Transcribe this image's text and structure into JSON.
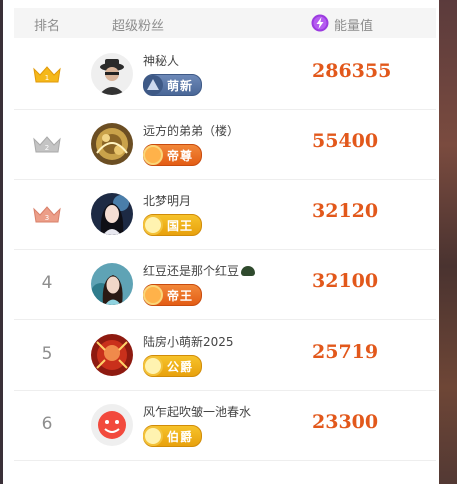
{
  "header": {
    "rank_label": "排名",
    "fan_label": "超级粉丝",
    "energy_label": "能量值"
  },
  "colors": {
    "energy": "#e2581b",
    "gold_crown": "#f5b81a",
    "silver_crown": "#b9b9b9",
    "bronze_crown": "#e99882"
  },
  "rows": [
    {
      "rank": "1",
      "rank_style": "gold-crown-icon",
      "name": "神秘人",
      "badge": "萌新",
      "badge_color": "blue",
      "energy": "286355"
    },
    {
      "rank": "2",
      "rank_style": "silver-crown-icon",
      "name": "远方的弟弟（楼）",
      "badge": "帝尊",
      "badge_color": "orange",
      "energy": "55400"
    },
    {
      "rank": "3",
      "rank_style": "bronze-crown-icon",
      "name": "北梦明月",
      "badge": "国王",
      "badge_color": "yellow",
      "energy": "32120"
    },
    {
      "rank": "4",
      "rank_style": "number",
      "name": "红豆还是那个红豆",
      "badge": "帝王",
      "badge_color": "orange",
      "energy": "32100"
    },
    {
      "rank": "5",
      "rank_style": "number",
      "name": "陆房小萌新2025",
      "badge": "公爵",
      "badge_color": "yellow",
      "energy": "25719"
    },
    {
      "rank": "6",
      "rank_style": "number",
      "name": "风乍起吹皱一池春水",
      "badge": "伯爵",
      "badge_color": "yellow",
      "energy": "23300"
    }
  ]
}
